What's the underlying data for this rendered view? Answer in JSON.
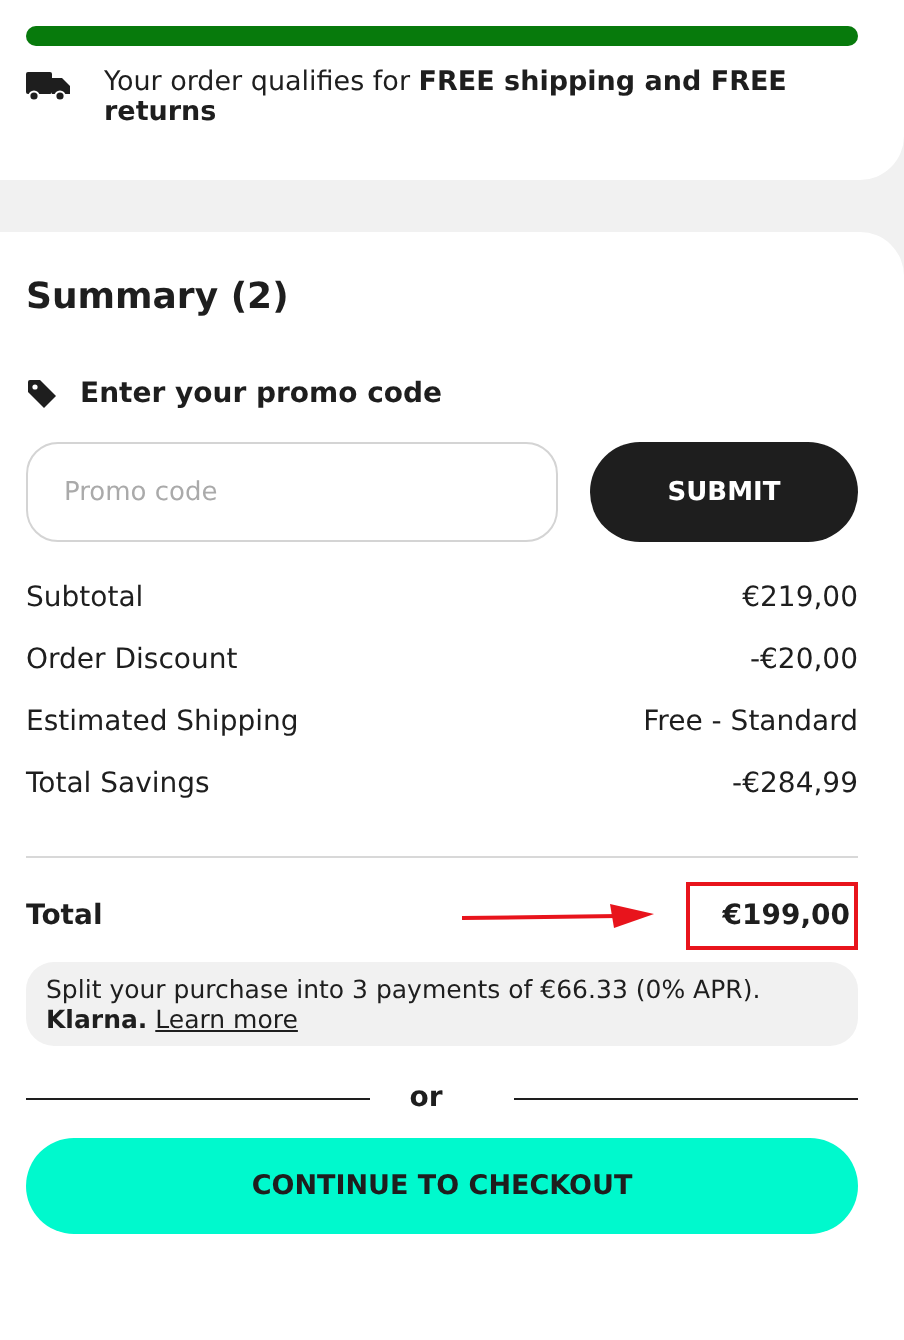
{
  "shipping": {
    "level": 1,
    "message": "Your order qualifies for **FREE shipping and FREE returns**"
  },
  "summary": {
    "title": "Summary (2)",
    "promo_label": "Enter your promo code",
    "promo_placeholder": "Promo code",
    "submit": "SUBMIT",
    "lines": [
      {
        "label": "Subtotal",
        "value": "€219,00"
      },
      {
        "label": "Order Discount",
        "value": "-€20,00"
      },
      {
        "label": "Estimated Shipping",
        "value": "Free - Standard"
      },
      {
        "label": "Total Savings",
        "value": "-€284,99"
      }
    ],
    "total_label": "Total",
    "total_value": "€199,00",
    "klarna": {
      "text": "Split your purchase into 3 payments of €66.33 (0% APR).",
      "brand": "Klarna.",
      "link": "Learn more"
    },
    "divider_text": "or",
    "checkout": "CONTINUE TO CHECKOUT"
  }
}
